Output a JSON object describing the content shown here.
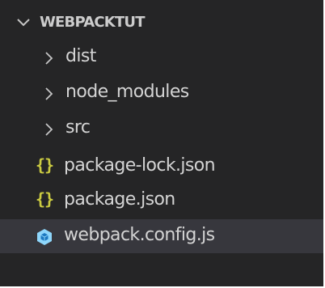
{
  "explorer": {
    "root": {
      "label": "WEBPACKTUT",
      "icon": "chevron-down-icon"
    },
    "items": [
      {
        "type": "folder",
        "label": "dist",
        "icon": "chevron-right-icon"
      },
      {
        "type": "folder",
        "label": "node_modules",
        "icon": "chevron-right-icon"
      },
      {
        "type": "folder",
        "label": "src",
        "icon": "chevron-right-icon"
      },
      {
        "type": "file",
        "label": "package-lock.json",
        "icon": "json-file-icon",
        "icon_glyph": "{}"
      },
      {
        "type": "file",
        "label": "package.json",
        "icon": "json-file-icon",
        "icon_glyph": "{}"
      },
      {
        "type": "file",
        "label": "webpack.config.js",
        "icon": "webpack-icon",
        "selected": true
      }
    ]
  },
  "colors": {
    "background": "#252526",
    "selected_row": "#37373d",
    "text": "#d4d4d4",
    "json_icon": "#cbcb41",
    "webpack_icon": "#8ed6fb"
  }
}
